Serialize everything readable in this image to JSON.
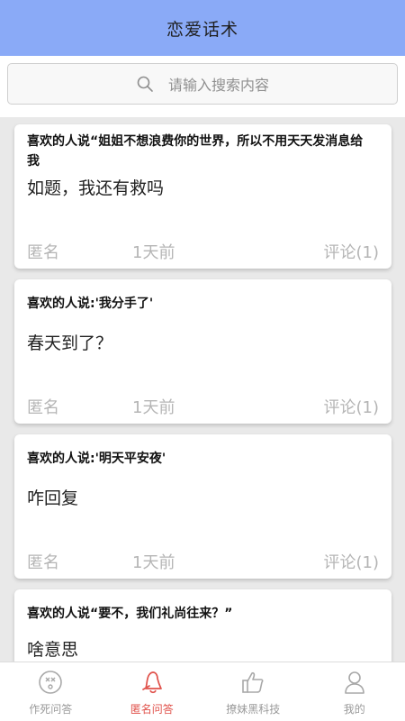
{
  "header": {
    "title": "恋爱话术"
  },
  "search": {
    "placeholder": "请输入搜索内容"
  },
  "posts": [
    {
      "title": "喜欢的人说“姐姐不想浪费你的世界，所以不用天天发消息给我",
      "body": "如题，我还有救吗",
      "author": "匿名",
      "time": "1天前",
      "comments": "评论(1)"
    },
    {
      "title": "喜欢的人说:'我分手了'",
      "body": "春天到了？",
      "author": "匿名",
      "time": "1天前",
      "comments": "评论(1)"
    },
    {
      "title": "喜欢的人说:'明天平安夜'",
      "body": "咋回复",
      "author": "匿名",
      "time": "1天前",
      "comments": "评论(1)"
    },
    {
      "title": "喜欢的人说“要不，我们礼尚往来？”",
      "body": "啥意思",
      "author": "",
      "time": "",
      "comments": ""
    }
  ],
  "tabs": [
    {
      "label": "作死问答",
      "icon": "dizzy-face-icon",
      "active": false
    },
    {
      "label": "匿名问答",
      "icon": "bell-icon",
      "active": true
    },
    {
      "label": "撩妹黑科技",
      "icon": "thumbs-up-icon",
      "active": false
    },
    {
      "label": "我的",
      "icon": "user-icon",
      "active": false
    }
  ],
  "colors": {
    "header_bg": "#8aaaf7",
    "active_tab": "#e0524b",
    "inactive_tab": "#9a9a9a"
  }
}
